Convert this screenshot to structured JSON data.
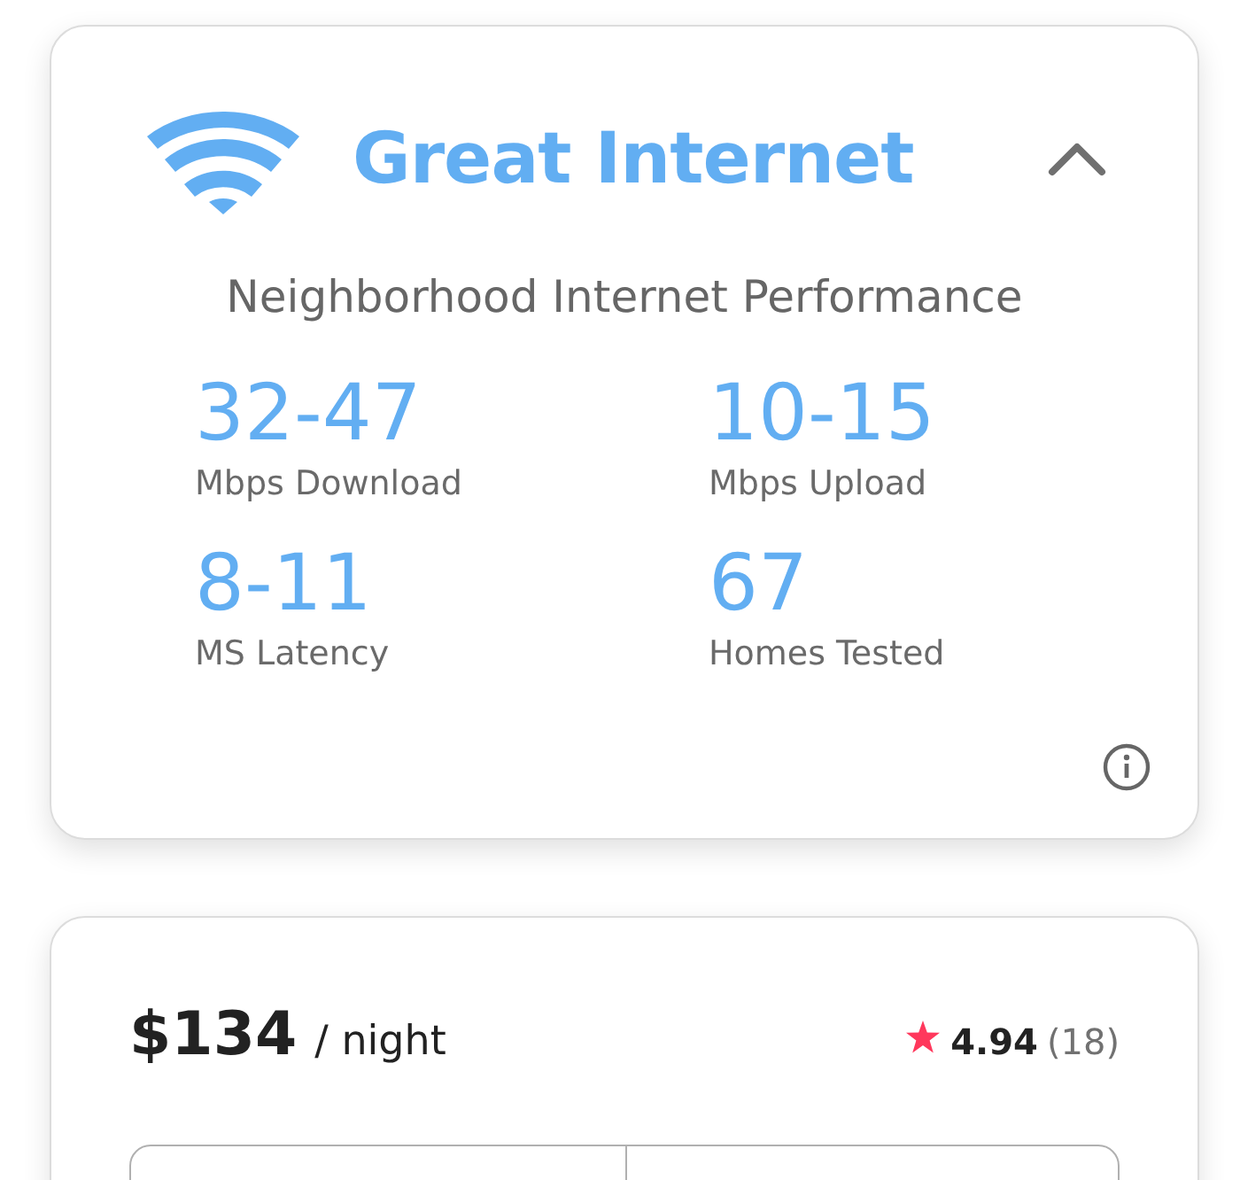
{
  "internet_card": {
    "title": "Great Internet",
    "expanded": true,
    "subtitle": "Neighborhood Internet Performance",
    "stats": [
      {
        "value": "32-47",
        "label": "Mbps Download"
      },
      {
        "value": "10-15",
        "label": "Mbps Upload"
      },
      {
        "value": "8-11",
        "label": "MS Latency"
      },
      {
        "value": "67",
        "label": "Homes Tested"
      }
    ]
  },
  "booking_card": {
    "price": "$134",
    "unit": "/ night",
    "rating": "4.94",
    "review_count": "(18)"
  }
}
